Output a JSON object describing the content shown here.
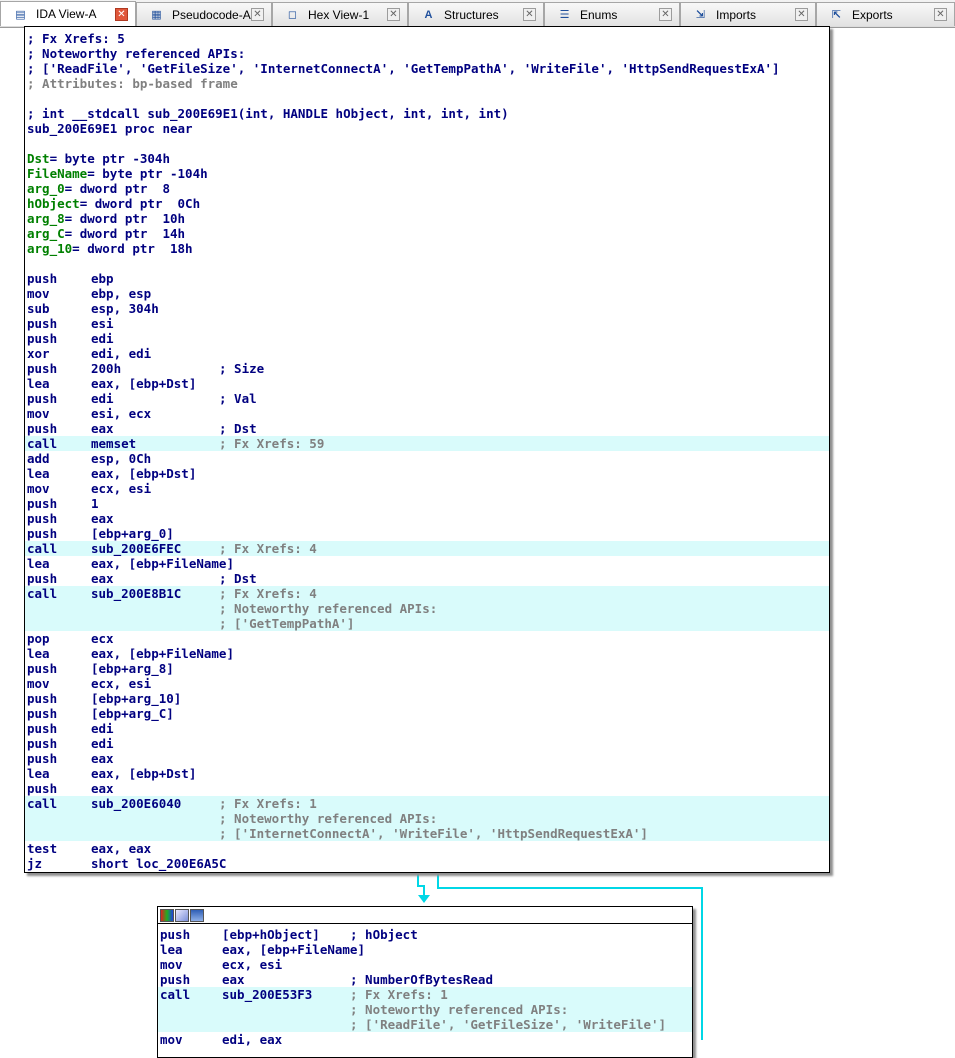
{
  "tabs": [
    {
      "label": "IDA View-A",
      "icon": "ida-view-icon",
      "active": true
    },
    {
      "label": "Pseudocode-A",
      "icon": "pseudocode-icon",
      "active": false
    },
    {
      "label": "Hex View-1",
      "icon": "hex-view-icon",
      "active": false
    },
    {
      "label": "Structures",
      "icon": "structures-icon",
      "active": false
    },
    {
      "label": "Enums",
      "icon": "enums-icon",
      "active": false
    },
    {
      "label": "Imports",
      "icon": "imports-icon",
      "active": false
    },
    {
      "label": "Exports",
      "icon": "exports-icon",
      "active": false
    }
  ],
  "main_block": {
    "header": [
      "; Fx Xrefs: 5",
      "; Noteworthy referenced APIs:",
      "; ['ReadFile', 'GetFileSize', 'InternetConnectA', 'GetTempPathA', 'WriteFile', 'HttpSendRequestExA']",
      "; Attributes: bp-based frame",
      "",
      "; int __stdcall sub_200E69E1(int, HANDLE hObject, int, int, int)",
      "sub_200E69E1 proc near",
      ""
    ],
    "vars": [
      {
        "name": "Dst",
        "def": "= byte ptr -304h"
      },
      {
        "name": "FileName",
        "def": "= byte ptr -104h"
      },
      {
        "name": "arg_0",
        "def": "= dword ptr  8"
      },
      {
        "name": "hObject",
        "def": "= dword ptr  0Ch"
      },
      {
        "name": "arg_8",
        "def": "= dword ptr  10h"
      },
      {
        "name": "arg_C",
        "def": "= dword ptr  14h"
      },
      {
        "name": "arg_10",
        "def": "= dword ptr  18h"
      }
    ],
    "instructions": [
      {
        "m": "push",
        "o": "ebp",
        "c": "",
        "hl": false
      },
      {
        "m": "mov",
        "o": "ebp, esp",
        "c": "",
        "hl": false
      },
      {
        "m": "sub",
        "o": "esp, 304h",
        "c": "",
        "hl": false
      },
      {
        "m": "push",
        "o": "esi",
        "c": "",
        "hl": false
      },
      {
        "m": "push",
        "o": "edi",
        "c": "",
        "hl": false
      },
      {
        "m": "xor",
        "o": "edi, edi",
        "c": "",
        "hl": false
      },
      {
        "m": "push",
        "o": "200h",
        "c": "; Size",
        "cb": true,
        "hl": false
      },
      {
        "m": "lea",
        "o": "eax, [ebp+Dst]",
        "c": "",
        "hl": false
      },
      {
        "m": "push",
        "o": "edi",
        "c": "; Val",
        "cb": true,
        "hl": false
      },
      {
        "m": "mov",
        "o": "esi, ecx",
        "c": "",
        "hl": false
      },
      {
        "m": "push",
        "o": "eax",
        "c": "; Dst",
        "cb": true,
        "hl": false
      },
      {
        "m": "call",
        "o": "memset",
        "c": "; Fx Xrefs: 59",
        "hl": true
      },
      {
        "m": "add",
        "o": "esp, 0Ch",
        "c": "",
        "hl": false
      },
      {
        "m": "lea",
        "o": "eax, [ebp+Dst]",
        "c": "",
        "hl": false
      },
      {
        "m": "mov",
        "o": "ecx, esi",
        "c": "",
        "hl": false
      },
      {
        "m": "push",
        "o": "1",
        "c": "",
        "hl": false
      },
      {
        "m": "push",
        "o": "eax",
        "c": "",
        "hl": false
      },
      {
        "m": "push",
        "o": "[ebp+arg_0]",
        "c": "",
        "hl": false
      },
      {
        "m": "call",
        "o": "sub_200E6FEC",
        "c": "; Fx Xrefs: 4",
        "hl": true
      },
      {
        "m": "lea",
        "o": "eax, [ebp+FileName]",
        "c": "",
        "hl": false
      },
      {
        "m": "push",
        "o": "eax",
        "c": "; Dst",
        "cb": true,
        "hl": false
      },
      {
        "m": "call",
        "o": "sub_200E8B1C",
        "c": "; Fx Xrefs: 4",
        "hl": true
      },
      {
        "m": "",
        "o": "",
        "c": "; Noteworthy referenced APIs:",
        "hl": true
      },
      {
        "m": "",
        "o": "",
        "c": "; ['GetTempPathA']",
        "hl": true
      },
      {
        "m": "pop",
        "o": "ecx",
        "c": "",
        "hl": false
      },
      {
        "m": "lea",
        "o": "eax, [ebp+FileName]",
        "c": "",
        "hl": false
      },
      {
        "m": "push",
        "o": "[ebp+arg_8]",
        "c": "",
        "hl": false
      },
      {
        "m": "mov",
        "o": "ecx, esi",
        "c": "",
        "hl": false
      },
      {
        "m": "push",
        "o": "[ebp+arg_10]",
        "c": "",
        "hl": false
      },
      {
        "m": "push",
        "o": "[ebp+arg_C]",
        "c": "",
        "hl": false
      },
      {
        "m": "push",
        "o": "edi",
        "c": "",
        "hl": false
      },
      {
        "m": "push",
        "o": "edi",
        "c": "",
        "hl": false
      },
      {
        "m": "push",
        "o": "eax",
        "c": "",
        "hl": false
      },
      {
        "m": "lea",
        "o": "eax, [ebp+Dst]",
        "c": "",
        "hl": false
      },
      {
        "m": "push",
        "o": "eax",
        "c": "",
        "hl": false
      },
      {
        "m": "call",
        "o": "sub_200E6040",
        "c": "; Fx Xrefs: 1",
        "hl": true
      },
      {
        "m": "",
        "o": "",
        "c": "; Noteworthy referenced APIs:",
        "hl": true
      },
      {
        "m": "",
        "o": "",
        "c": "; ['InternetConnectA', 'WriteFile', 'HttpSendRequestExA']",
        "hl": true
      },
      {
        "m": "test",
        "o": "eax, eax",
        "c": "",
        "hl": false
      },
      {
        "m": "jz",
        "o": "short loc_200E6A5C",
        "c": "",
        "hl": false
      }
    ]
  },
  "second_block": {
    "instructions": [
      {
        "m": "push",
        "o": "[ebp+hObject]",
        "c": "; hObject",
        "cb": true,
        "hl": false
      },
      {
        "m": "lea",
        "o": "eax, [ebp+FileName]",
        "c": "",
        "hl": false
      },
      {
        "m": "mov",
        "o": "ecx, esi",
        "c": "",
        "hl": false
      },
      {
        "m": "push",
        "o": "eax",
        "c": "; NumberOfBytesRead",
        "cb": true,
        "hl": false
      },
      {
        "m": "call",
        "o": "sub_200E53F3",
        "c": "; Fx Xrefs: 1",
        "hl": true
      },
      {
        "m": "",
        "o": "",
        "c": "; Noteworthy referenced APIs:",
        "hl": true
      },
      {
        "m": "",
        "o": "",
        "c": "; ['ReadFile', 'GetFileSize', 'WriteFile']",
        "hl": true
      },
      {
        "m": "mov",
        "o": "edi, eax",
        "c": "",
        "hl": false
      }
    ]
  },
  "colors": {
    "highlight": "#d9fbfb",
    "code": "#000080",
    "comment": "#808080",
    "name": "#008000",
    "edge": "#00d7e6"
  }
}
